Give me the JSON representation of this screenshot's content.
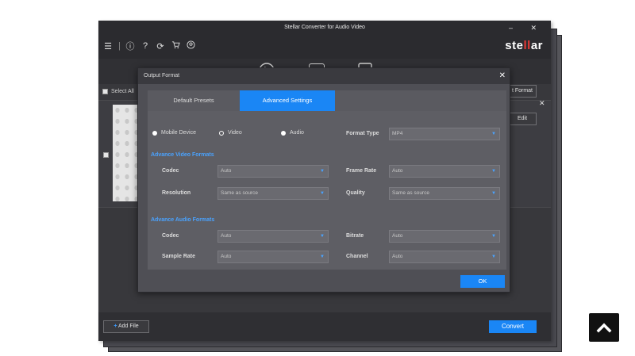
{
  "app": {
    "title": "Stellar Converter for Audio Video",
    "window_buttons": "–  ✕",
    "logo_pre": "ste",
    "logo_red": "ll",
    "logo_post": "ar",
    "toolbar_icons": [
      "menu-icon",
      "info-icon",
      "help-icon",
      "refresh-icon",
      "cart-icon",
      "user-icon"
    ],
    "format_icons": [
      "play-icon",
      "gif-icon",
      "video-file-icon"
    ]
  },
  "list": {
    "select_all_label": "Select All",
    "format_button_fragment": "t Format",
    "edit_button": "Edit",
    "row_close": "✕"
  },
  "footer": {
    "add_file_label": "Add File",
    "convert_label": "Convert"
  },
  "dialog": {
    "title": "Output Format",
    "close": "✕",
    "tabs": {
      "default": "Default Presets",
      "active": "Advanced Settings"
    },
    "radios": {
      "mobile": "Mobile Device",
      "video": "Video",
      "audio": "Audio",
      "selected": "Video"
    },
    "format_type": {
      "label": "Format Type",
      "value": "MP4"
    },
    "video_section": "Advance Video Formats",
    "video": {
      "codec": {
        "label": "Codec",
        "value": "Auto"
      },
      "frame_rate": {
        "label": "Frame Rate",
        "value": "Auto"
      },
      "resolution": {
        "label": "Resolution",
        "value": "Same as source"
      },
      "quality": {
        "label": "Quality",
        "value": "Same as source"
      }
    },
    "audio_section": "Advance Audio Formats",
    "audio": {
      "codec": {
        "label": "Codec",
        "value": "Auto"
      },
      "bitrate": {
        "label": "Bitrate",
        "value": "Auto"
      },
      "sample_rate": {
        "label": "Sample Rate",
        "value": "Auto"
      },
      "channel": {
        "label": "Channel",
        "value": "Auto"
      }
    },
    "ok_label": "OK"
  },
  "colors": {
    "accent": "#1a86f5",
    "section": "#4aa3ff",
    "logo_red": "#e53935"
  }
}
